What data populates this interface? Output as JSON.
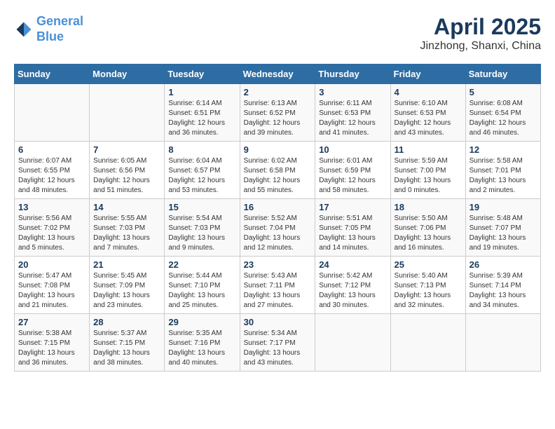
{
  "header": {
    "logo_line1": "General",
    "logo_line2": "Blue",
    "month_title": "April 2025",
    "location": "Jinzhong, Shanxi, China"
  },
  "weekdays": [
    "Sunday",
    "Monday",
    "Tuesday",
    "Wednesday",
    "Thursday",
    "Friday",
    "Saturday"
  ],
  "weeks": [
    [
      {
        "day": "",
        "sunrise": "",
        "sunset": "",
        "daylight": ""
      },
      {
        "day": "",
        "sunrise": "",
        "sunset": "",
        "daylight": ""
      },
      {
        "day": "1",
        "sunrise": "Sunrise: 6:14 AM",
        "sunset": "Sunset: 6:51 PM",
        "daylight": "Daylight: 12 hours and 36 minutes."
      },
      {
        "day": "2",
        "sunrise": "Sunrise: 6:13 AM",
        "sunset": "Sunset: 6:52 PM",
        "daylight": "Daylight: 12 hours and 39 minutes."
      },
      {
        "day": "3",
        "sunrise": "Sunrise: 6:11 AM",
        "sunset": "Sunset: 6:53 PM",
        "daylight": "Daylight: 12 hours and 41 minutes."
      },
      {
        "day": "4",
        "sunrise": "Sunrise: 6:10 AM",
        "sunset": "Sunset: 6:53 PM",
        "daylight": "Daylight: 12 hours and 43 minutes."
      },
      {
        "day": "5",
        "sunrise": "Sunrise: 6:08 AM",
        "sunset": "Sunset: 6:54 PM",
        "daylight": "Daylight: 12 hours and 46 minutes."
      }
    ],
    [
      {
        "day": "6",
        "sunrise": "Sunrise: 6:07 AM",
        "sunset": "Sunset: 6:55 PM",
        "daylight": "Daylight: 12 hours and 48 minutes."
      },
      {
        "day": "7",
        "sunrise": "Sunrise: 6:05 AM",
        "sunset": "Sunset: 6:56 PM",
        "daylight": "Daylight: 12 hours and 51 minutes."
      },
      {
        "day": "8",
        "sunrise": "Sunrise: 6:04 AM",
        "sunset": "Sunset: 6:57 PM",
        "daylight": "Daylight: 12 hours and 53 minutes."
      },
      {
        "day": "9",
        "sunrise": "Sunrise: 6:02 AM",
        "sunset": "Sunset: 6:58 PM",
        "daylight": "Daylight: 12 hours and 55 minutes."
      },
      {
        "day": "10",
        "sunrise": "Sunrise: 6:01 AM",
        "sunset": "Sunset: 6:59 PM",
        "daylight": "Daylight: 12 hours and 58 minutes."
      },
      {
        "day": "11",
        "sunrise": "Sunrise: 5:59 AM",
        "sunset": "Sunset: 7:00 PM",
        "daylight": "Daylight: 13 hours and 0 minutes."
      },
      {
        "day": "12",
        "sunrise": "Sunrise: 5:58 AM",
        "sunset": "Sunset: 7:01 PM",
        "daylight": "Daylight: 13 hours and 2 minutes."
      }
    ],
    [
      {
        "day": "13",
        "sunrise": "Sunrise: 5:56 AM",
        "sunset": "Sunset: 7:02 PM",
        "daylight": "Daylight: 13 hours and 5 minutes."
      },
      {
        "day": "14",
        "sunrise": "Sunrise: 5:55 AM",
        "sunset": "Sunset: 7:03 PM",
        "daylight": "Daylight: 13 hours and 7 minutes."
      },
      {
        "day": "15",
        "sunrise": "Sunrise: 5:54 AM",
        "sunset": "Sunset: 7:03 PM",
        "daylight": "Daylight: 13 hours and 9 minutes."
      },
      {
        "day": "16",
        "sunrise": "Sunrise: 5:52 AM",
        "sunset": "Sunset: 7:04 PM",
        "daylight": "Daylight: 13 hours and 12 minutes."
      },
      {
        "day": "17",
        "sunrise": "Sunrise: 5:51 AM",
        "sunset": "Sunset: 7:05 PM",
        "daylight": "Daylight: 13 hours and 14 minutes."
      },
      {
        "day": "18",
        "sunrise": "Sunrise: 5:50 AM",
        "sunset": "Sunset: 7:06 PM",
        "daylight": "Daylight: 13 hours and 16 minutes."
      },
      {
        "day": "19",
        "sunrise": "Sunrise: 5:48 AM",
        "sunset": "Sunset: 7:07 PM",
        "daylight": "Daylight: 13 hours and 19 minutes."
      }
    ],
    [
      {
        "day": "20",
        "sunrise": "Sunrise: 5:47 AM",
        "sunset": "Sunset: 7:08 PM",
        "daylight": "Daylight: 13 hours and 21 minutes."
      },
      {
        "day": "21",
        "sunrise": "Sunrise: 5:45 AM",
        "sunset": "Sunset: 7:09 PM",
        "daylight": "Daylight: 13 hours and 23 minutes."
      },
      {
        "day": "22",
        "sunrise": "Sunrise: 5:44 AM",
        "sunset": "Sunset: 7:10 PM",
        "daylight": "Daylight: 13 hours and 25 minutes."
      },
      {
        "day": "23",
        "sunrise": "Sunrise: 5:43 AM",
        "sunset": "Sunset: 7:11 PM",
        "daylight": "Daylight: 13 hours and 27 minutes."
      },
      {
        "day": "24",
        "sunrise": "Sunrise: 5:42 AM",
        "sunset": "Sunset: 7:12 PM",
        "daylight": "Daylight: 13 hours and 30 minutes."
      },
      {
        "day": "25",
        "sunrise": "Sunrise: 5:40 AM",
        "sunset": "Sunset: 7:13 PM",
        "daylight": "Daylight: 13 hours and 32 minutes."
      },
      {
        "day": "26",
        "sunrise": "Sunrise: 5:39 AM",
        "sunset": "Sunset: 7:14 PM",
        "daylight": "Daylight: 13 hours and 34 minutes."
      }
    ],
    [
      {
        "day": "27",
        "sunrise": "Sunrise: 5:38 AM",
        "sunset": "Sunset: 7:15 PM",
        "daylight": "Daylight: 13 hours and 36 minutes."
      },
      {
        "day": "28",
        "sunrise": "Sunrise: 5:37 AM",
        "sunset": "Sunset: 7:15 PM",
        "daylight": "Daylight: 13 hours and 38 minutes."
      },
      {
        "day": "29",
        "sunrise": "Sunrise: 5:35 AM",
        "sunset": "Sunset: 7:16 PM",
        "daylight": "Daylight: 13 hours and 40 minutes."
      },
      {
        "day": "30",
        "sunrise": "Sunrise: 5:34 AM",
        "sunset": "Sunset: 7:17 PM",
        "daylight": "Daylight: 13 hours and 43 minutes."
      },
      {
        "day": "",
        "sunrise": "",
        "sunset": "",
        "daylight": ""
      },
      {
        "day": "",
        "sunrise": "",
        "sunset": "",
        "daylight": ""
      },
      {
        "day": "",
        "sunrise": "",
        "sunset": "",
        "daylight": ""
      }
    ]
  ]
}
